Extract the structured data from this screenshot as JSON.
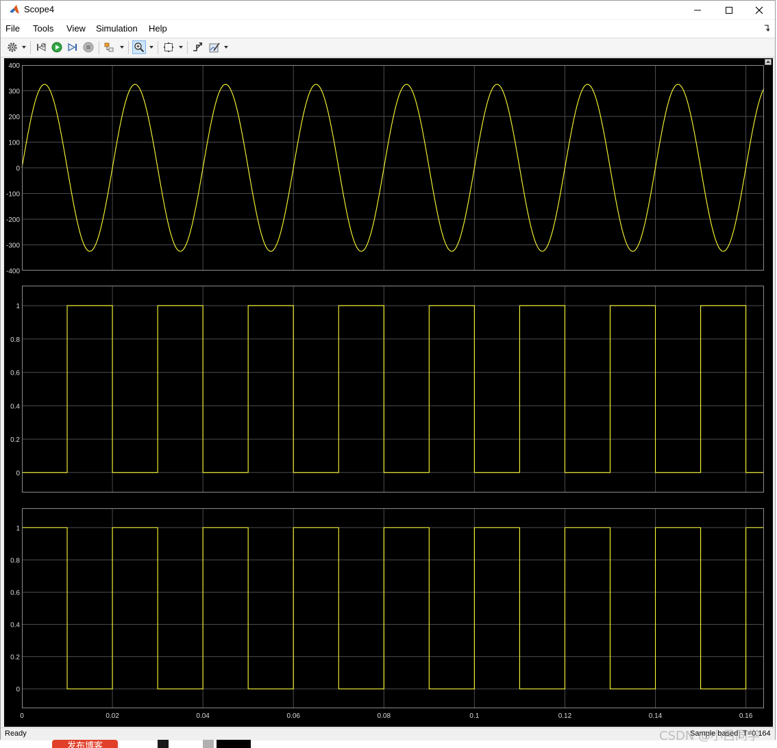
{
  "window": {
    "title": "Scope4",
    "icon": "matlab-icon",
    "controls": [
      "minimize-icon",
      "maximize-icon",
      "close-icon"
    ]
  },
  "menu": {
    "items": [
      "File",
      "Tools",
      "View",
      "Simulation",
      "Help"
    ],
    "overflow_icon": "menu-arrow-icon"
  },
  "toolbar": {
    "items": [
      {
        "icon": "gear-icon",
        "has_dropdown": true
      },
      {
        "icon": "step-back-icon",
        "has_dropdown": false
      },
      {
        "icon": "run-icon",
        "has_dropdown": false
      },
      {
        "icon": "step-forward-icon",
        "has_dropdown": false
      },
      {
        "icon": "stop-icon",
        "has_dropdown": false
      },
      {
        "icon": "highlight-block-icon",
        "has_dropdown": true
      },
      {
        "icon": "zoom-in-icon",
        "has_dropdown": true,
        "active": true
      },
      {
        "icon": "fit-to-view-icon",
        "has_dropdown": true
      },
      {
        "icon": "triggers-icon",
        "has_dropdown": false
      },
      {
        "icon": "style-icon",
        "has_dropdown": true
      }
    ]
  },
  "colors": {
    "trace": "#ffff33",
    "axes_background": "#000000",
    "grid": "#4d4d4d",
    "axes_border": "#8c8c8c",
    "tick_label": "#dcdcdc"
  },
  "chart_data": [
    {
      "type": "line",
      "title": "",
      "xlim": [
        0,
        0.164
      ],
      "ylim": [
        -400,
        400
      ],
      "yticks": [
        "-400",
        "-300",
        "-200",
        "-100",
        "0",
        "100",
        "200",
        "300",
        "400"
      ],
      "yticks_values": [
        -400,
        -300,
        -200,
        -100,
        0,
        100,
        200,
        300,
        400
      ],
      "xticks_values": [
        0,
        0.02,
        0.04,
        0.06,
        0.08,
        0.1,
        0.12,
        0.14,
        0.16
      ],
      "grid": true,
      "series": [
        {
          "kind": "sine",
          "amplitude": 325,
          "frequency_hz": 50,
          "phase_deg": 0,
          "offset": 0
        }
      ]
    },
    {
      "type": "line",
      "title": "",
      "xlim": [
        0,
        0.164
      ],
      "ylim": [
        -0.12,
        1.12
      ],
      "yticks": [
        "0",
        "0.2",
        "0.4",
        "0.6",
        "0.8",
        "1"
      ],
      "yticks_values": [
        0,
        0.2,
        0.4,
        0.6,
        0.8,
        1
      ],
      "xticks_values": [
        0,
        0.02,
        0.04,
        0.06,
        0.08,
        0.1,
        0.12,
        0.14,
        0.16
      ],
      "grid": true,
      "series": [
        {
          "kind": "pulse",
          "period": 0.02,
          "high": 1,
          "low": 0,
          "high_intervals_start_offset": 0.01,
          "pulse_width": 0.01
        }
      ]
    },
    {
      "type": "line",
      "title": "",
      "xlim": [
        0,
        0.164
      ],
      "ylim": [
        -0.12,
        1.12
      ],
      "yticks": [
        "0",
        "0.2",
        "0.4",
        "0.6",
        "0.8",
        "1"
      ],
      "yticks_values": [
        0,
        0.2,
        0.4,
        0.6,
        0.8,
        1
      ],
      "xticks": [
        "0",
        "0.02",
        "0.04",
        "0.06",
        "0.08",
        "0.1",
        "0.12",
        "0.14",
        "0.16"
      ],
      "xticks_values": [
        0,
        0.02,
        0.04,
        0.06,
        0.08,
        0.1,
        0.12,
        0.14,
        0.16
      ],
      "grid": true,
      "series": [
        {
          "kind": "pulse",
          "period": 0.02,
          "high": 1,
          "low": 0,
          "high_intervals_start_offset": 0,
          "pulse_width": 0.01
        }
      ]
    }
  ],
  "status": {
    "left": "Ready",
    "mode": "Sample based",
    "time": "T=0.164"
  },
  "watermark": "CSDN @小吕同学",
  "background": {
    "publish_button": "发布博客"
  }
}
